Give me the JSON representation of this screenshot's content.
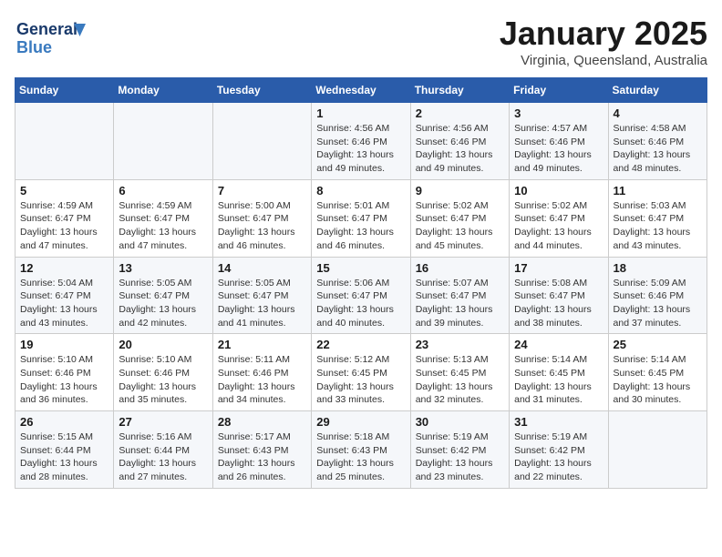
{
  "header": {
    "logo_line1": "General",
    "logo_line2": "Blue",
    "month": "January 2025",
    "location": "Virginia, Queensland, Australia"
  },
  "weekdays": [
    "Sunday",
    "Monday",
    "Tuesday",
    "Wednesday",
    "Thursday",
    "Friday",
    "Saturday"
  ],
  "weeks": [
    [
      {
        "day": "",
        "info": ""
      },
      {
        "day": "",
        "info": ""
      },
      {
        "day": "",
        "info": ""
      },
      {
        "day": "1",
        "info": "Sunrise: 4:56 AM\nSunset: 6:46 PM\nDaylight: 13 hours\nand 49 minutes."
      },
      {
        "day": "2",
        "info": "Sunrise: 4:56 AM\nSunset: 6:46 PM\nDaylight: 13 hours\nand 49 minutes."
      },
      {
        "day": "3",
        "info": "Sunrise: 4:57 AM\nSunset: 6:46 PM\nDaylight: 13 hours\nand 49 minutes."
      },
      {
        "day": "4",
        "info": "Sunrise: 4:58 AM\nSunset: 6:46 PM\nDaylight: 13 hours\nand 48 minutes."
      }
    ],
    [
      {
        "day": "5",
        "info": "Sunrise: 4:59 AM\nSunset: 6:47 PM\nDaylight: 13 hours\nand 47 minutes."
      },
      {
        "day": "6",
        "info": "Sunrise: 4:59 AM\nSunset: 6:47 PM\nDaylight: 13 hours\nand 47 minutes."
      },
      {
        "day": "7",
        "info": "Sunrise: 5:00 AM\nSunset: 6:47 PM\nDaylight: 13 hours\nand 46 minutes."
      },
      {
        "day": "8",
        "info": "Sunrise: 5:01 AM\nSunset: 6:47 PM\nDaylight: 13 hours\nand 46 minutes."
      },
      {
        "day": "9",
        "info": "Sunrise: 5:02 AM\nSunset: 6:47 PM\nDaylight: 13 hours\nand 45 minutes."
      },
      {
        "day": "10",
        "info": "Sunrise: 5:02 AM\nSunset: 6:47 PM\nDaylight: 13 hours\nand 44 minutes."
      },
      {
        "day": "11",
        "info": "Sunrise: 5:03 AM\nSunset: 6:47 PM\nDaylight: 13 hours\nand 43 minutes."
      }
    ],
    [
      {
        "day": "12",
        "info": "Sunrise: 5:04 AM\nSunset: 6:47 PM\nDaylight: 13 hours\nand 43 minutes."
      },
      {
        "day": "13",
        "info": "Sunrise: 5:05 AM\nSunset: 6:47 PM\nDaylight: 13 hours\nand 42 minutes."
      },
      {
        "day": "14",
        "info": "Sunrise: 5:05 AM\nSunset: 6:47 PM\nDaylight: 13 hours\nand 41 minutes."
      },
      {
        "day": "15",
        "info": "Sunrise: 5:06 AM\nSunset: 6:47 PM\nDaylight: 13 hours\nand 40 minutes."
      },
      {
        "day": "16",
        "info": "Sunrise: 5:07 AM\nSunset: 6:47 PM\nDaylight: 13 hours\nand 39 minutes."
      },
      {
        "day": "17",
        "info": "Sunrise: 5:08 AM\nSunset: 6:47 PM\nDaylight: 13 hours\nand 38 minutes."
      },
      {
        "day": "18",
        "info": "Sunrise: 5:09 AM\nSunset: 6:46 PM\nDaylight: 13 hours\nand 37 minutes."
      }
    ],
    [
      {
        "day": "19",
        "info": "Sunrise: 5:10 AM\nSunset: 6:46 PM\nDaylight: 13 hours\nand 36 minutes."
      },
      {
        "day": "20",
        "info": "Sunrise: 5:10 AM\nSunset: 6:46 PM\nDaylight: 13 hours\nand 35 minutes."
      },
      {
        "day": "21",
        "info": "Sunrise: 5:11 AM\nSunset: 6:46 PM\nDaylight: 13 hours\nand 34 minutes."
      },
      {
        "day": "22",
        "info": "Sunrise: 5:12 AM\nSunset: 6:45 PM\nDaylight: 13 hours\nand 33 minutes."
      },
      {
        "day": "23",
        "info": "Sunrise: 5:13 AM\nSunset: 6:45 PM\nDaylight: 13 hours\nand 32 minutes."
      },
      {
        "day": "24",
        "info": "Sunrise: 5:14 AM\nSunset: 6:45 PM\nDaylight: 13 hours\nand 31 minutes."
      },
      {
        "day": "25",
        "info": "Sunrise: 5:14 AM\nSunset: 6:45 PM\nDaylight: 13 hours\nand 30 minutes."
      }
    ],
    [
      {
        "day": "26",
        "info": "Sunrise: 5:15 AM\nSunset: 6:44 PM\nDaylight: 13 hours\nand 28 minutes."
      },
      {
        "day": "27",
        "info": "Sunrise: 5:16 AM\nSunset: 6:44 PM\nDaylight: 13 hours\nand 27 minutes."
      },
      {
        "day": "28",
        "info": "Sunrise: 5:17 AM\nSunset: 6:43 PM\nDaylight: 13 hours\nand 26 minutes."
      },
      {
        "day": "29",
        "info": "Sunrise: 5:18 AM\nSunset: 6:43 PM\nDaylight: 13 hours\nand 25 minutes."
      },
      {
        "day": "30",
        "info": "Sunrise: 5:19 AM\nSunset: 6:42 PM\nDaylight: 13 hours\nand 23 minutes."
      },
      {
        "day": "31",
        "info": "Sunrise: 5:19 AM\nSunset: 6:42 PM\nDaylight: 13 hours\nand 22 minutes."
      },
      {
        "day": "",
        "info": ""
      }
    ]
  ]
}
